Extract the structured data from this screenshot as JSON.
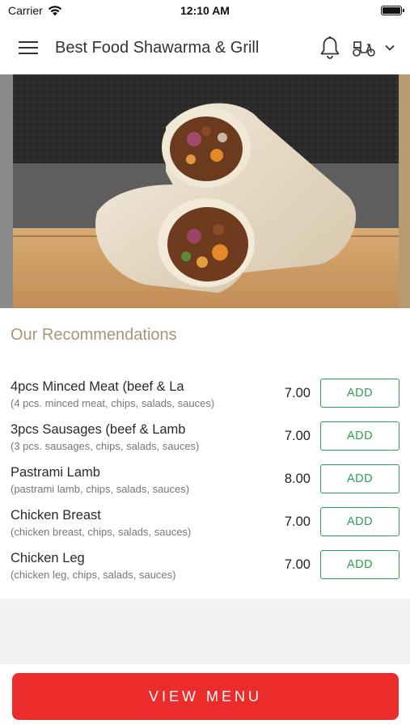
{
  "status_bar": {
    "carrier": "Carrier",
    "time": "12:10 AM"
  },
  "header": {
    "title": "Best Food Shawarma & Grill",
    "icons": [
      "hamburger-menu-icon",
      "bell-icon",
      "scooter-icon",
      "chevron-down-icon"
    ]
  },
  "hero": {
    "image": "shawarma-wrap-photo"
  },
  "recommendations": {
    "title": "Our Recommendations",
    "items": [
      {
        "name": "4pcs Minced Meat (beef & La",
        "description": "(4 pcs. minced meat, chips, salads, sauces)",
        "price": "7.00",
        "button": "ADD"
      },
      {
        "name": "3pcs Sausages (beef & Lamb",
        "description": "(3 pcs. sausages, chips, salads, sauces)",
        "price": "7.00",
        "button": "ADD"
      },
      {
        "name": "Pastrami Lamb",
        "description": "(pastrami lamb, chips, salads, sauces)",
        "price": "8.00",
        "button": "ADD"
      },
      {
        "name": "Chicken Breast",
        "description": "(chicken breast, chips, salads, sauces)",
        "price": "7.00",
        "button": "ADD"
      },
      {
        "name": "Chicken Leg",
        "description": "(chicken leg, chips, salads, sauces)",
        "price": "7.00",
        "button": "ADD"
      }
    ]
  },
  "footer": {
    "view_menu": "VIEW MENU"
  },
  "colors": {
    "accent_green": "#2e9e52",
    "cta_red": "#ec2b2b",
    "section_title": "#a6977a"
  }
}
